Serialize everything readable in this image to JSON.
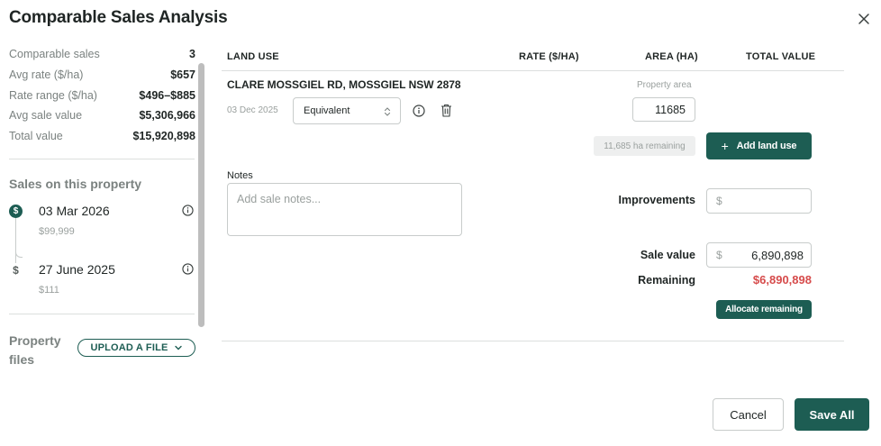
{
  "modal": {
    "title": "Comparable Sales Analysis"
  },
  "summary": [
    {
      "label": "Comparable sales",
      "value": "3"
    },
    {
      "label": "Avg rate ($/ha)",
      "value": "$657"
    },
    {
      "label": "Rate range ($/ha)",
      "value": "$496–$885"
    },
    {
      "label": "Avg sale value",
      "value": "$5,306,966"
    },
    {
      "label": "Total value",
      "value": "$15,920,898"
    }
  ],
  "sales_section": {
    "title": "Sales on this property",
    "items": [
      {
        "date": "03 Mar 2026",
        "price": "$99,999",
        "icon": "$"
      },
      {
        "date": "27 June 2025",
        "price": "$111",
        "icon": "$"
      }
    ]
  },
  "files": {
    "label_line1": "Property",
    "label_line2": "files",
    "upload_label": "UPLOAD A FILE"
  },
  "table": {
    "headers": {
      "land_use": "LAND USE",
      "rate": "RATE ($/HA)",
      "area": "AREA (HA)",
      "total": "TOTAL VALUE"
    },
    "address": "CLARE MOSSGIEL RD, MOSSGIEL NSW 2878",
    "row_date": "03 Dec 2025",
    "land_use_value": "Equivalent",
    "area_caption": "Property area",
    "area_value": "11685",
    "remaining_badge": "11,685 ha remaining",
    "add_land_use": "Add land use"
  },
  "notes": {
    "label": "Notes",
    "placeholder": "Add sale notes..."
  },
  "values": {
    "improvements_label": "Improvements",
    "improvements_value": "",
    "sale_value_label": "Sale value",
    "sale_value": "6,890,898",
    "currency_symbol": "$",
    "remaining_label": "Remaining",
    "remaining_value": "$6,890,898",
    "allocate_label": "Allocate remaining"
  },
  "footer": {
    "cancel": "Cancel",
    "save": "Save All"
  },
  "colors": {
    "brand": "#1d5d53",
    "danger": "#d64b4b",
    "muted": "#7b8280"
  }
}
